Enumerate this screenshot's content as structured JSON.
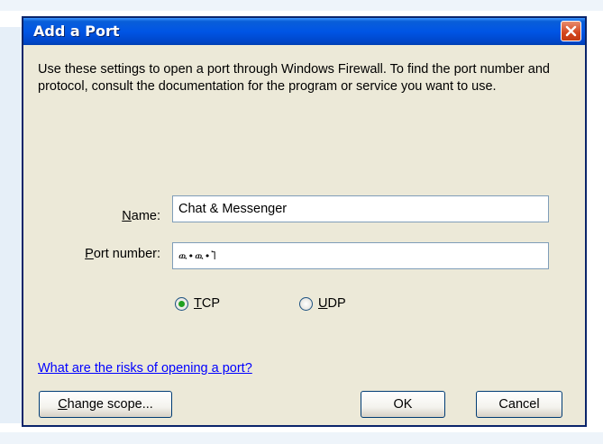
{
  "dialog": {
    "title": "Add a Port",
    "intro": "Use these settings to open a port through Windows Firewall. To find the port number and protocol, consult the documentation for the program or service you want to use."
  },
  "fields": {
    "name": {
      "label_key": "N",
      "label_rest": "ame:",
      "value": "Chat & Messenger"
    },
    "port": {
      "label_key": "P",
      "label_rest": "ort number:",
      "value": "ዉ•ዉ•Ⴈ"
    }
  },
  "protocol": {
    "selected": "TCP",
    "options": [
      {
        "key": "T",
        "rest": "CP"
      },
      {
        "key": "U",
        "rest": "DP"
      }
    ]
  },
  "help_link": "What are the risks of opening a port?",
  "buttons": {
    "scope_key": "C",
    "scope_rest": "hange scope...",
    "ok": "OK",
    "cancel": "Cancel"
  },
  "colors": {
    "titlebar": "#0055e5",
    "dialog_bg": "#ece9d8",
    "link": "#0000ff",
    "close_button": "#d3441c"
  }
}
